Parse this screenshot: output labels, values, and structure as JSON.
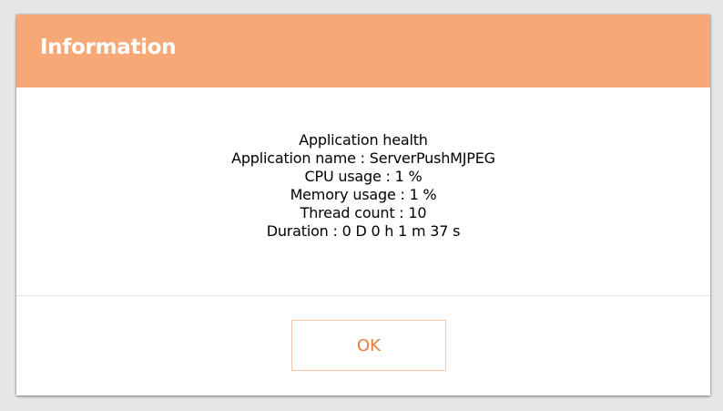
{
  "dialog": {
    "title": "Information",
    "message_lines": [
      "Application health",
      "Application name : ServerPushMJPEG",
      "CPU usage : 1 %",
      "Memory usage : 1 %",
      "Thread count : 10",
      "Duration : 0 D 0 h 1 m 37 s"
    ],
    "ok_label": "OK"
  },
  "colors": {
    "header": "#f6a877",
    "title_text": "#ffffff",
    "button_text": "#ee7a35",
    "button_border": "#f3c4a6",
    "backdrop": "#e6e6e6"
  }
}
